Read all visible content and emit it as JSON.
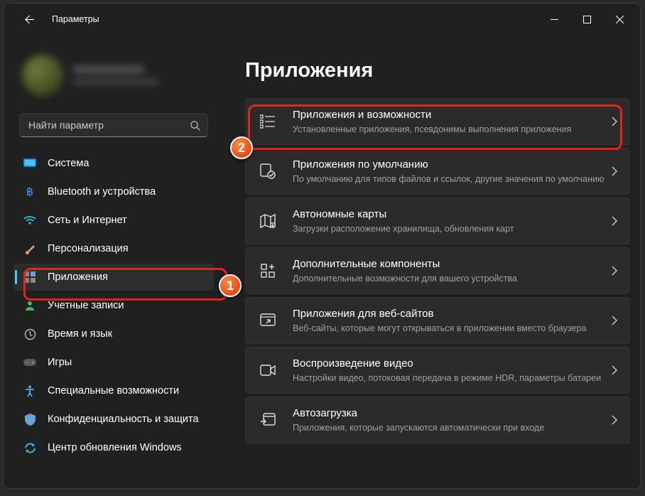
{
  "window": {
    "title": "Параметры"
  },
  "search": {
    "placeholder": "Найти параметр"
  },
  "sidebar": {
    "items": [
      {
        "label": "Система"
      },
      {
        "label": "Bluetooth и устройства"
      },
      {
        "label": "Сеть и Интернет"
      },
      {
        "label": "Персонализация"
      },
      {
        "label": "Приложения"
      },
      {
        "label": "Учетные записи"
      },
      {
        "label": "Время и язык"
      },
      {
        "label": "Игры"
      },
      {
        "label": "Специальные возможности"
      },
      {
        "label": "Конфиденциальность и защита"
      },
      {
        "label": "Центр обновления Windows"
      }
    ]
  },
  "main": {
    "heading": "Приложения",
    "tiles": [
      {
        "title": "Приложения и возможности",
        "sub": "Установленные приложения, псевдонимы выполнения приложения"
      },
      {
        "title": "Приложения по умолчанию",
        "sub": "По умолчанию для типов файлов и ссылок, другие значения по умолчанию"
      },
      {
        "title": "Автономные карты",
        "sub": "Загрузки расположение хранилища, обновления карт"
      },
      {
        "title": "Дополнительные компоненты",
        "sub": "Дополнительные возможности для вашего устройства"
      },
      {
        "title": "Приложения для веб-сайтов",
        "sub": "Веб-сайты, которые могут открываться в приложении вместо браузера"
      },
      {
        "title": "Воспроизведение видео",
        "sub": "Настройки видео, потоковая передача в режиме HDR, параметры батареи"
      },
      {
        "title": "Автозагрузка",
        "sub": "Приложения, которые запускаются автоматически при входе"
      }
    ]
  },
  "callouts": {
    "b1": "1",
    "b2": "2"
  }
}
